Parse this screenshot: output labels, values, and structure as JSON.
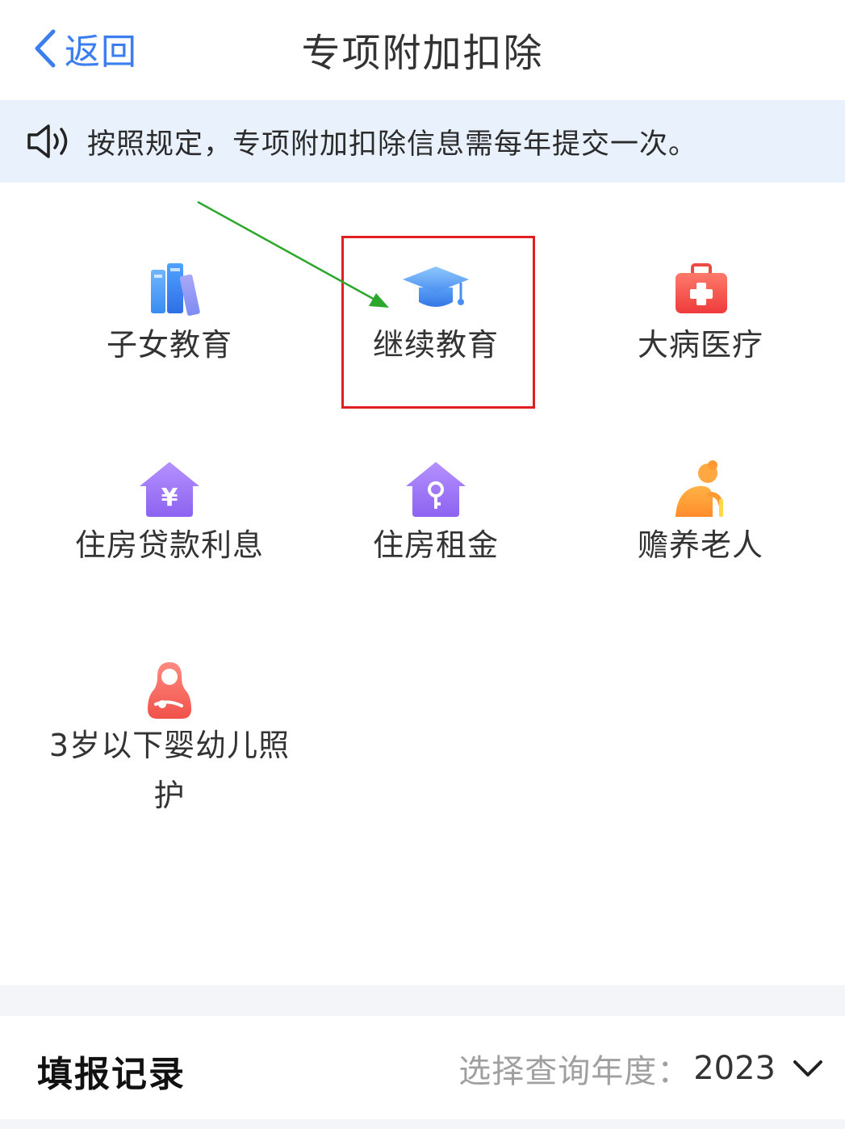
{
  "header": {
    "back_label": "返回",
    "title": "专项附加扣除"
  },
  "notice": {
    "icon": "speaker-icon",
    "text": "按照规定，专项附加扣除信息需每年提交一次。"
  },
  "items": [
    {
      "label": "子女教育",
      "icon": "books-icon"
    },
    {
      "label": "继续教育",
      "icon": "graduation-cap-icon",
      "highlighted": true
    },
    {
      "label": "大病医疗",
      "icon": "first-aid-kit-icon"
    },
    {
      "label": "住房贷款利息",
      "icon": "house-yen-icon"
    },
    {
      "label": "住房租金",
      "icon": "house-key-icon"
    },
    {
      "label": "赡养老人",
      "icon": "elderly-person-icon"
    },
    {
      "label": "3岁以下婴幼儿照\n护",
      "icon": "mother-baby-icon"
    }
  ],
  "records": {
    "title": "填报记录",
    "year_prefix": "选择查询年度：",
    "year_value": "2023"
  },
  "colors": {
    "accent": "#3c7ef0",
    "highlight_border": "#e02020",
    "arrow": "#2ba82b",
    "notice_bg": "#e9f1fc"
  }
}
